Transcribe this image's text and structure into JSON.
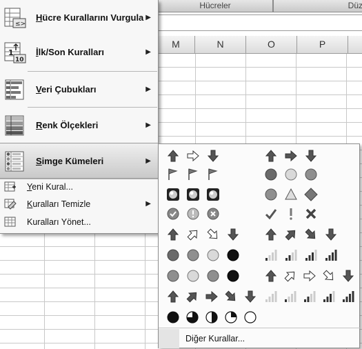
{
  "ribbon": {
    "group_cells": "Hücreler",
    "group_edit": "Düz"
  },
  "columns": [
    "M",
    "N",
    "O",
    "P"
  ],
  "menu": {
    "items": [
      {
        "label": "Hücre Kurallarını Vurgula",
        "underline": "H",
        "rest": "ücre Kurallarını Vurgula",
        "icon": "highlight-cells-rules-icon",
        "has_submenu": true
      },
      {
        "label": "İlk/Son Kuralları",
        "underline": "İ",
        "rest": "lk/Son Kuralları",
        "icon": "top-bottom-rules-icon",
        "has_submenu": true
      },
      {
        "label": "Veri Çubukları",
        "underline": "V",
        "rest": "eri Çubukları",
        "icon": "data-bars-icon",
        "has_submenu": true
      },
      {
        "label": "Renk Ölçekleri",
        "underline": "R",
        "rest": "enk Ölçekleri",
        "icon": "color-scales-icon",
        "has_submenu": true
      },
      {
        "label": "Simge Kümeleri",
        "underline": "S",
        "rest": "imge Kümeleri",
        "icon": "icon-sets-icon",
        "has_submenu": true,
        "selected": true
      }
    ],
    "small_items": [
      {
        "label": "Yeni Kural...",
        "underline": "Y",
        "rest": "eni Kural...",
        "icon": "new-rule-icon",
        "has_submenu": false
      },
      {
        "label": "Kuralları Temizle",
        "underline": "K",
        "rest": "uralları Temizle",
        "icon": "clear-rules-icon",
        "has_submenu": true
      },
      {
        "label": "Kuralları Yönet...",
        "underline": "",
        "rest": "Kuralları Yönet...",
        "icon": "manage-rules-icon",
        "has_submenu": false
      }
    ]
  },
  "submenu": {
    "icon_sets": [
      {
        "name": "3-arrows-colored",
        "icons": [
          "arrow-up",
          "arrow-right-outline",
          "arrow-down"
        ]
      },
      {
        "name": "3-arrows-gray",
        "icons": [
          "arrow-up",
          "arrow-right",
          "arrow-down"
        ]
      },
      {
        "name": "3-flags",
        "icons": [
          "flag",
          "flag",
          "flag"
        ]
      },
      {
        "name": "3-traffic-lights-unrimmed",
        "icons": [
          "circle-dark",
          "circle-light",
          "circle-mid"
        ]
      },
      {
        "name": "3-traffic-lights-rimmed",
        "icons": [
          "square-light",
          "square-light",
          "square-light"
        ]
      },
      {
        "name": "3-signs",
        "icons": [
          "circle-mid",
          "triangle",
          "diamond"
        ]
      },
      {
        "name": "3-symbols-circled",
        "icons": [
          "check-circle",
          "exclaim-circle",
          "x-circle"
        ]
      },
      {
        "name": "3-symbols-uncircled",
        "icons": [
          "check",
          "exclaim",
          "x-mark"
        ]
      },
      {
        "name": "4-arrows-colored",
        "icons": [
          "arrow-up",
          "arrow-up-right-outline",
          "arrow-down-right-outline",
          "arrow-down"
        ]
      },
      {
        "name": "4-arrows-gray",
        "icons": [
          "arrow-up",
          "arrow-up-right",
          "arrow-down-right",
          "arrow-down"
        ]
      },
      {
        "name": "red-to-black",
        "icons": [
          "circle-dark",
          "circle-mid",
          "circle-light",
          "circle-black"
        ]
      },
      {
        "name": "4-ratings",
        "icons": [
          "bars-1",
          "bars-2",
          "bars-3",
          "bars-4"
        ]
      },
      {
        "name": "4-traffic-lights",
        "icons": [
          "circle-mid",
          "circle-light",
          "circle-mid",
          "circle-black"
        ]
      },
      {
        "name": "5-arrows-colored",
        "icons": [
          "arrow-up",
          "arrow-up-right-outline",
          "arrow-right-outline",
          "arrow-down-right-outline",
          "arrow-down"
        ]
      },
      {
        "name": "5-arrows-gray",
        "icons": [
          "arrow-up",
          "arrow-up-right",
          "arrow-right",
          "arrow-down-right",
          "arrow-down"
        ]
      },
      {
        "name": "5-ratings",
        "icons": [
          "bars-0",
          "bars-1",
          "bars-2",
          "bars-3",
          "bars-4"
        ]
      },
      {
        "name": "5-quarters",
        "icons": [
          "quarter-4",
          "quarter-3",
          "quarter-2",
          "quarter-1",
          "quarter-0"
        ]
      }
    ],
    "more_rules": {
      "label": "Diğer Kurallar...",
      "underline": "ğ"
    }
  }
}
